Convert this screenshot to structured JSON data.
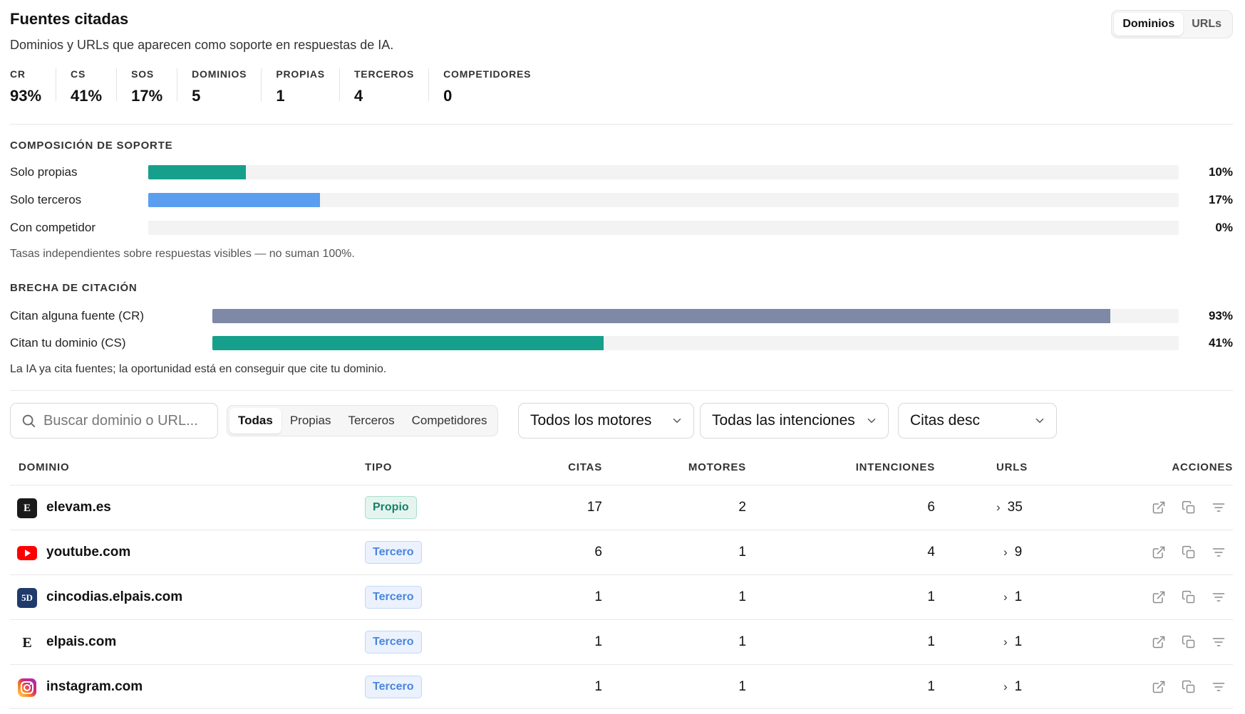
{
  "header": {
    "title": "Fuentes citadas",
    "subtitle": "Dominios y URLs que aparecen como soporte en respuestas de IA.",
    "view_toggle": [
      "Dominios",
      "URLs"
    ],
    "view_active": "Dominios"
  },
  "kpis": [
    {
      "label": "CR",
      "value": "93%"
    },
    {
      "label": "CS",
      "value": "41%"
    },
    {
      "label": "SOS",
      "value": "17%"
    },
    {
      "label": "DOMINIOS",
      "value": "5"
    },
    {
      "label": "PROPIAS",
      "value": "1"
    },
    {
      "label": "TERCEROS",
      "value": "4"
    },
    {
      "label": "COMPETIDORES",
      "value": "0"
    }
  ],
  "composition": {
    "title": "COMPOSICIÓN DE SOPORTE",
    "rows": [
      {
        "label": "Solo propias",
        "pct_text": "10%",
        "fraction": 0.095,
        "color": "#16a08b"
      },
      {
        "label": "Solo terceros",
        "pct_text": "17%",
        "fraction": 0.167,
        "color": "#5b9ef0"
      },
      {
        "label": "Con competidor",
        "pct_text": "0%",
        "fraction": 0.0,
        "color": "#e05a5a"
      }
    ],
    "note": "Tasas independientes sobre respuestas visibles — no suman 100%."
  },
  "gap": {
    "title": "BRECHA DE CITACIÓN",
    "rows": [
      {
        "label": "Citan alguna fuente (CR)",
        "pct_text": "93%",
        "fraction": 0.929,
        "color": "#7d89a6"
      },
      {
        "label": "Citan tu dominio (CS)",
        "pct_text": "41%",
        "fraction": 0.405,
        "color": "#16a08b"
      }
    ],
    "note": "La IA ya cita fuentes; la oportunidad está en conseguir que cite tu dominio."
  },
  "filters": {
    "search_placeholder": "Buscar dominio o URL...",
    "type_options": [
      "Todas",
      "Propias",
      "Terceros",
      "Competidores"
    ],
    "type_active": "Todas",
    "engine": "Todos los motores",
    "intent": "Todas las intenciones",
    "sort": "Citas desc"
  },
  "table": {
    "headers": {
      "domain": "DOMINIO",
      "type": "TIPO",
      "cites": "CITAS",
      "engines": "MOTORES",
      "intents": "INTENCIONES",
      "urls": "URLS",
      "actions": "ACCIONES"
    },
    "rows": [
      {
        "domain": "elevam.es",
        "favicon": "elevam-favicon",
        "favicon_text": "E",
        "type": "Propio",
        "cites": "17",
        "engines": "2",
        "intents": "6",
        "urls": "35"
      },
      {
        "domain": "youtube.com",
        "favicon": "youtube-icon",
        "favicon_text": "",
        "type": "Tercero",
        "cites": "6",
        "engines": "1",
        "intents": "4",
        "urls": "9"
      },
      {
        "domain": "cincodias.elpais.com",
        "favicon": "cincodias-favicon",
        "favicon_text": "5D",
        "type": "Tercero",
        "cites": "1",
        "engines": "1",
        "intents": "1",
        "urls": "1"
      },
      {
        "domain": "elpais.com",
        "favicon": "elpais-favicon",
        "favicon_text": "E",
        "type": "Tercero",
        "cites": "1",
        "engines": "1",
        "intents": "1",
        "urls": "1"
      },
      {
        "domain": "instagram.com",
        "favicon": "instagram-icon",
        "favicon_text": "",
        "type": "Tercero",
        "cites": "1",
        "engines": "1",
        "intents": "1",
        "urls": "1"
      }
    ]
  }
}
